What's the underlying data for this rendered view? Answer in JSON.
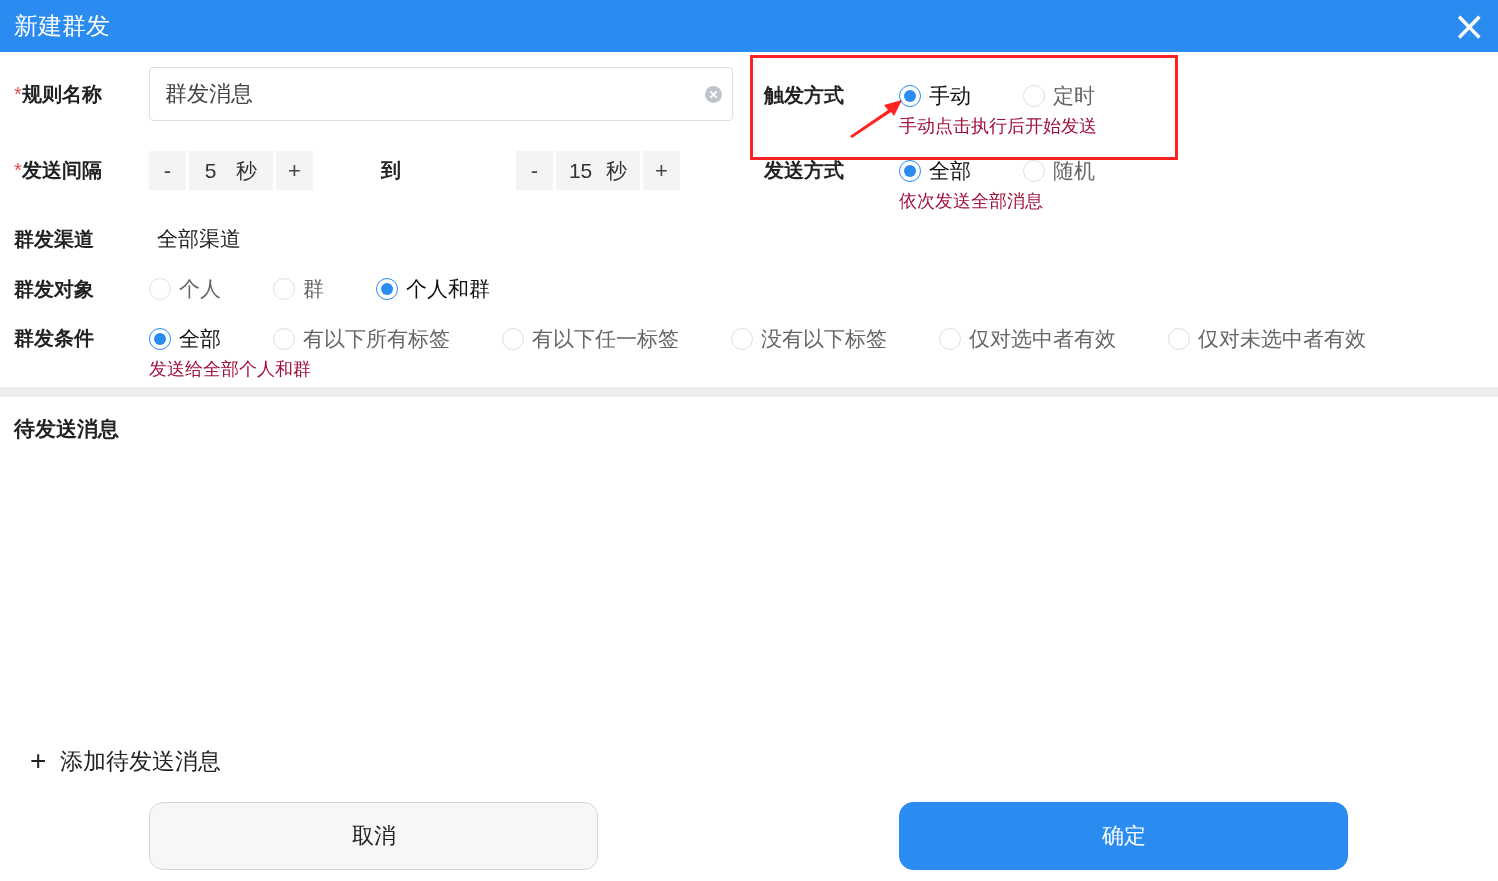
{
  "window": {
    "title": "新建群发",
    "close": "×"
  },
  "rule_name": {
    "required_mark": "*",
    "label": "规则名称",
    "value": "群发消息"
  },
  "interval": {
    "required_mark": "*",
    "label": "发送间隔",
    "from": {
      "minus": "-",
      "value": "5",
      "unit": "秒",
      "plus": "+"
    },
    "separator": "到",
    "to": {
      "minus": "-",
      "value": "15",
      "unit": "秒",
      "plus": "+"
    }
  },
  "trigger": {
    "label": "触发方式",
    "options": [
      {
        "label": "手动",
        "selected": true
      },
      {
        "label": "定时",
        "selected": false
      }
    ],
    "hint": "手动点击执行后开始发送"
  },
  "send_mode": {
    "label": "发送方式",
    "options": [
      {
        "label": "全部",
        "selected": true
      },
      {
        "label": "随机",
        "selected": false
      }
    ],
    "hint": "依次发送全部消息"
  },
  "channel": {
    "label": "群发渠道",
    "value": "全部渠道"
  },
  "target": {
    "label": "群发对象",
    "options": [
      {
        "label": "个人",
        "selected": false
      },
      {
        "label": "群",
        "selected": false
      },
      {
        "label": "个人和群",
        "selected": true
      }
    ]
  },
  "condition": {
    "label": "群发条件",
    "options": [
      {
        "label": "全部",
        "selected": true
      },
      {
        "label": "有以下所有标签",
        "selected": false
      },
      {
        "label": "有以下任一标签",
        "selected": false
      },
      {
        "label": "没有以下标签",
        "selected": false
      },
      {
        "label": "仅对选中者有效",
        "selected": false
      },
      {
        "label": "仅对未选中者有效",
        "selected": false
      }
    ],
    "hint": "发送给全部个人和群"
  },
  "messages": {
    "title": "待发送消息"
  },
  "add_message": {
    "icon": "+",
    "label": "添加待发送消息"
  },
  "buttons": [
    {
      "label": "取消",
      "kind": "secondary"
    },
    {
      "label": "确定",
      "kind": "primary"
    }
  ]
}
